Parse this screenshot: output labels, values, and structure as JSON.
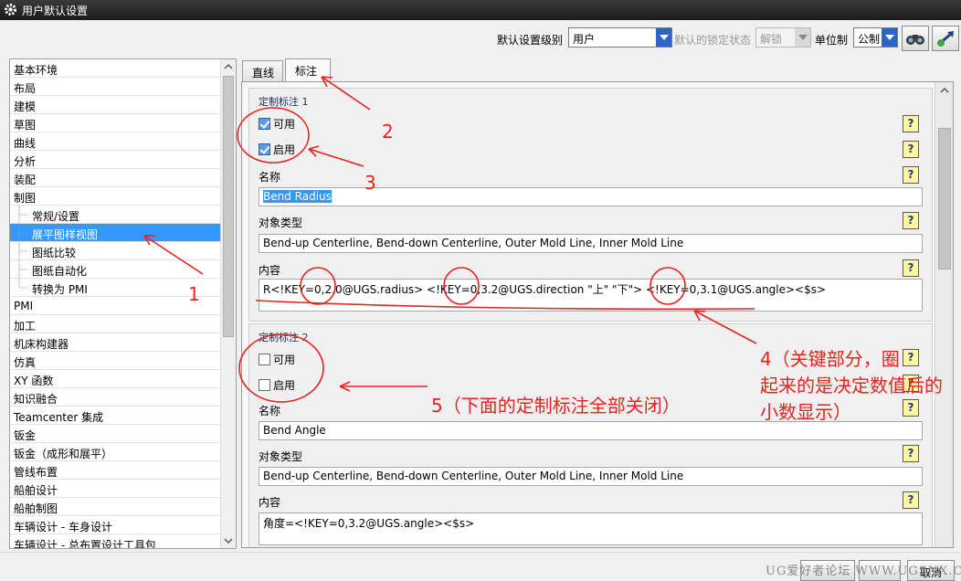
{
  "window": {
    "title": "用户默认设置"
  },
  "toolbar": {
    "level_label": "默认设置级别",
    "level_value": "用户",
    "lock_label": "默认的锁定状态",
    "lock_value": "解锁",
    "unit_label": "单位制",
    "unit_value": "公制"
  },
  "tree": {
    "items": [
      {
        "label": "基本环境"
      },
      {
        "label": "布局"
      },
      {
        "label": "建模"
      },
      {
        "label": "草图"
      },
      {
        "label": "曲线"
      },
      {
        "label": "分析"
      },
      {
        "label": "装配"
      },
      {
        "label": "制图"
      },
      {
        "label": "常规/设置"
      },
      {
        "label": "展平图样视图"
      },
      {
        "label": "图纸比较"
      },
      {
        "label": "图纸自动化"
      },
      {
        "label": "转换为 PMI"
      },
      {
        "label": "PMI"
      },
      {
        "label": "加工"
      },
      {
        "label": "机床构建器"
      },
      {
        "label": "仿真"
      },
      {
        "label": "XY 函数"
      },
      {
        "label": "知识融合"
      },
      {
        "label": "Teamcenter 集成"
      },
      {
        "label": "钣金"
      },
      {
        "label": "钣金（成形和展平）"
      },
      {
        "label": "管线布置"
      },
      {
        "label": "船舶设计"
      },
      {
        "label": "船舶制图"
      },
      {
        "label": "车辆设计 - 车身设计"
      },
      {
        "label": "车辆设计 - 总布置设计工具包"
      }
    ]
  },
  "tabs": [
    {
      "label": "直线"
    },
    {
      "label": "标注"
    }
  ],
  "groups": [
    {
      "title": "定制标注 1",
      "usable_label": "可用",
      "usable_checked": true,
      "enable_label": "启用",
      "enable_checked": true,
      "name_label": "名称",
      "name_value": "Bend Radius",
      "type_label": "对象类型",
      "type_value": "Bend-up Centerline, Bend-down Centerline, Outer Mold Line, Inner Mold Line",
      "content_label": "内容",
      "content_value": "R<!KEY=0,2.0@UGS.radius>  <!KEY=0,3.2@UGS.direction \"上\" \"下\">  <!KEY=0,3.1@UGS.angle><$s>"
    },
    {
      "title": "定制标注 2",
      "usable_label": "可用",
      "usable_checked": false,
      "enable_label": "启用",
      "enable_checked": false,
      "name_label": "名称",
      "name_value": "Bend Angle",
      "type_label": "对象类型",
      "type_value": "Bend-up Centerline, Bend-down Centerline, Outer Mold Line, Inner Mold Line",
      "content_label": "内容",
      "content_value": "角度=<!KEY=0,3.2@UGS.angle><$s>"
    }
  ],
  "help_glyph": "?",
  "bottom": {
    "watermark": "UG爱好者论坛 WWW.UGSNX.COM",
    "cancel_label": "取消"
  },
  "annotations": {
    "a1": "1",
    "a2": "2",
    "a3": "3",
    "a4_line1": "4（关键部分，圈",
    "a4_line2": "起来的是决定数值后的",
    "a4_line3": "小数显示）",
    "a5": "5（下面的定制标注全部关闭）",
    "color": "#e8231e"
  },
  "colors": {
    "selection": "#3399ff",
    "titlebar": "#2a2a2a",
    "help_bg": "#fff6a0"
  }
}
